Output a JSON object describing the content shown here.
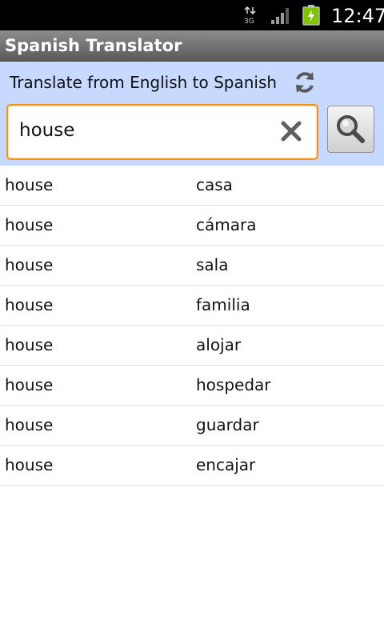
{
  "status_bar": {
    "network": "3G",
    "time": "12:47"
  },
  "app": {
    "title": "Spanish Translator"
  },
  "search": {
    "direction_label": "Translate from English to Spanish",
    "query": "house"
  },
  "results": [
    {
      "english": "house",
      "spanish": "casa"
    },
    {
      "english": "house",
      "spanish": "cámara"
    },
    {
      "english": "house",
      "spanish": "sala"
    },
    {
      "english": "house",
      "spanish": "familia"
    },
    {
      "english": "house",
      "spanish": "alojar"
    },
    {
      "english": "house",
      "spanish": "hospedar"
    },
    {
      "english": "house",
      "spanish": "guardar"
    },
    {
      "english": "house",
      "spanish": "encajar"
    }
  ],
  "colors": {
    "accent_focus": "#f2941f",
    "search_panel_bg": "#c8d9ff",
    "battery_fill": "#7fc400"
  },
  "icons": {
    "network": "data-network-icon",
    "signal": "signal-strength-icon",
    "battery": "battery-charging-icon",
    "refresh": "refresh-icon",
    "clear": "clear-x-icon",
    "search": "magnifier-icon"
  }
}
